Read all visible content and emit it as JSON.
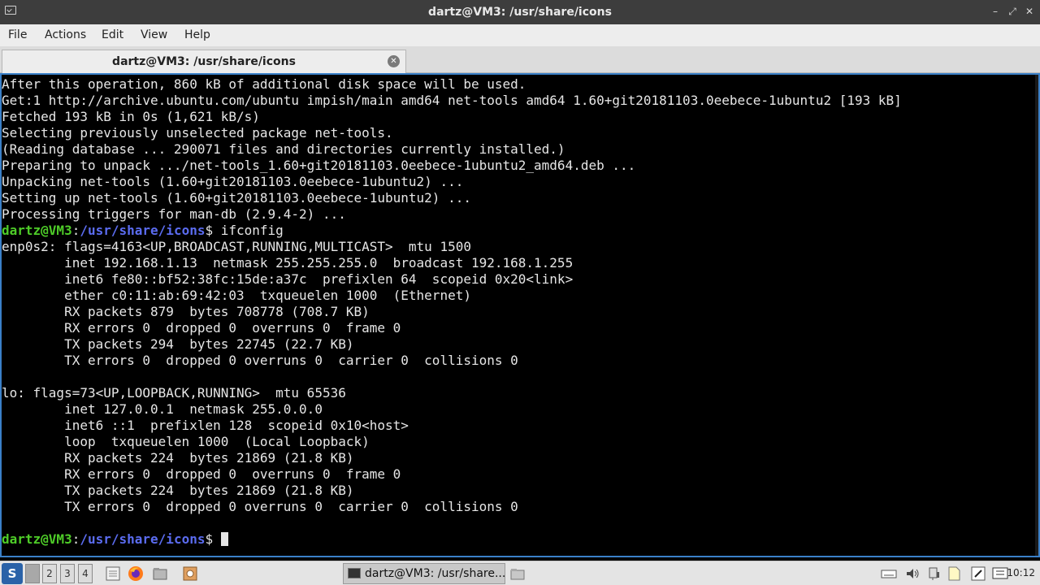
{
  "window": {
    "title": "dartz@VM3: /usr/share/icons",
    "minimize_glyph": "–",
    "maximize_glyph": "⤢",
    "close_glyph": "✕"
  },
  "menubar": {
    "items": [
      "File",
      "Actions",
      "Edit",
      "View",
      "Help"
    ]
  },
  "tab": {
    "label": "dartz@VM3: /usr/share/icons",
    "close_glyph": "✕"
  },
  "terminal": {
    "prompt": {
      "user_host": "dartz@VM3",
      "separator": ":",
      "path": "/usr/share/icons",
      "symbol": "$"
    },
    "lines_before": [
      "After this operation, 860 kB of additional disk space will be used.",
      "Get:1 http://archive.ubuntu.com/ubuntu impish/main amd64 net-tools amd64 1.60+git20181103.0eebece-1ubuntu2 [193 kB]",
      "Fetched 193 kB in 0s (1,621 kB/s)",
      "Selecting previously unselected package net-tools.",
      "(Reading database ... 290071 files and directories currently installed.)",
      "Preparing to unpack .../net-tools_1.60+git20181103.0eebece-1ubuntu2_amd64.deb ...",
      "Unpacking net-tools (1.60+git20181103.0eebece-1ubuntu2) ...",
      "Setting up net-tools (1.60+git20181103.0eebece-1ubuntu2) ...",
      "Processing triggers for man-db (2.9.4-2) ..."
    ],
    "command": " ifconfig",
    "output": [
      "enp0s2: flags=4163<UP,BROADCAST,RUNNING,MULTICAST>  mtu 1500",
      "        inet 192.168.1.13  netmask 255.255.255.0  broadcast 192.168.1.255",
      "        inet6 fe80::bf52:38fc:15de:a37c  prefixlen 64  scopeid 0x20<link>",
      "        ether c0:11:ab:69:42:03  txqueuelen 1000  (Ethernet)",
      "        RX packets 879  bytes 708778 (708.7 KB)",
      "        RX errors 0  dropped 0  overruns 0  frame 0",
      "        TX packets 294  bytes 22745 (22.7 KB)",
      "        TX errors 0  dropped 0 overruns 0  carrier 0  collisions 0",
      "",
      "lo: flags=73<UP,LOOPBACK,RUNNING>  mtu 65536",
      "        inet 127.0.0.1  netmask 255.0.0.0",
      "        inet6 ::1  prefixlen 128  scopeid 0x10<host>",
      "        loop  txqueuelen 1000  (Local Loopback)",
      "        RX packets 224  bytes 21869 (21.8 KB)",
      "        RX errors 0  dropped 0  overruns 0  frame 0",
      "        TX packets 224  bytes 21869 (21.8 KB)",
      "        TX errors 0  dropped 0 overruns 0  carrier 0  collisions 0",
      ""
    ],
    "colors": {
      "user_host": "#4ecc28",
      "path": "#5b6cf0",
      "text": "#e6e6e6",
      "background": "#000000",
      "focus_border": "#3a80c8"
    }
  },
  "taskbar": {
    "workspaces": [
      "",
      "2",
      "3",
      "4"
    ],
    "active_workspace": 1,
    "task_label": "dartz@VM3: /usr/share...",
    "clock": "10:12",
    "launchers": [
      "file-manager-icon",
      "firefox-icon",
      "files-icon",
      "settings-icon"
    ],
    "tray": [
      "keyboard-icon",
      "volume-icon",
      "network-icon",
      "notes-icon",
      "search-icon",
      "display-icon"
    ]
  }
}
